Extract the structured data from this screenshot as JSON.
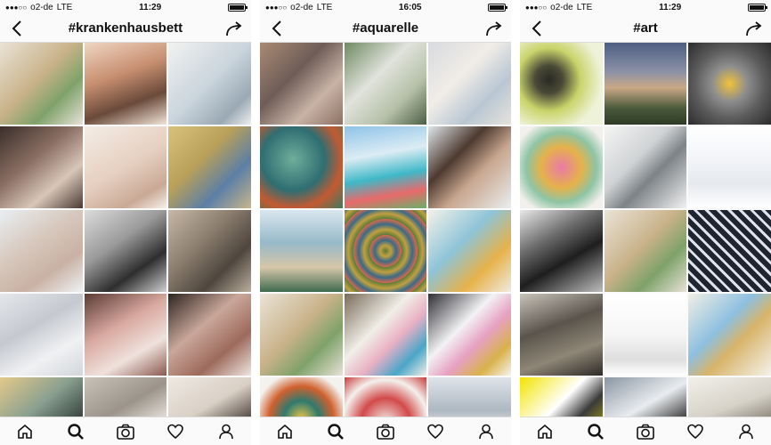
{
  "screens": [
    {
      "status": {
        "carrier": "o2-de",
        "network": "LTE",
        "time": "11:29"
      },
      "title": "#krankenhausbett",
      "tiles": [
        {
          "bg": "linear-gradient(135deg,#eae3d6 0%,#c9b28a 45%,#7fa26a 70%,#e8e2d8 100%)"
        },
        {
          "bg": "linear-gradient(160deg,#f0d6c2 0%,#c78e70 40%,#6a4a3a 70%,#f2e4d8 100%)"
        },
        {
          "bg": "linear-gradient(135deg,#f2f2f0 0%,#c9d4dc 50%,#9aa9b4 80%,#eeeeee 100%)"
        },
        {
          "bg": "linear-gradient(140deg,#3a2e2a 0%,#8a6e62 40%,#d8c6b8 70%,#4a3a34 100%)"
        },
        {
          "bg": "linear-gradient(150deg,#f4ede6 0%,#e6cfc0 50%,#c9a995 80%,#f7f0ea 100%)"
        },
        {
          "bg": "linear-gradient(135deg,#d8c27a 0%,#b9a05a 40%,#5c7fa6 70%,#c8b68a 100%)"
        },
        {
          "bg": "linear-gradient(145deg,#e9eef2 0%,#d7c8bd 40%,#c9b1a3 70%,#eef2f4 100%)"
        },
        {
          "bg": "linear-gradient(145deg,#dcdcdc 0%,#9a9a9a 40%,#2e2e2e 70%,#cfcfcf 100%)"
        },
        {
          "bg": "linear-gradient(135deg,#c7b8a6 0%,#8a7d6e 40%,#4e463e 70%,#b9ad9c 100%)"
        },
        {
          "bg": "linear-gradient(150deg,#e4e6ea 0%,#c5c9cf 40%,#f0f1f3 70%,#d2d6db 100%)"
        },
        {
          "bg": "linear-gradient(150deg,#5a3b34 0%,#d9a9a0 40%,#efe1dc 70%,#8a5a50 100%)"
        },
        {
          "bg": "linear-gradient(140deg,#2e2420 0%,#c9a79a 40%,#9d6a5c 70%,#efe6e0 100%)"
        },
        {
          "bg": "linear-gradient(140deg,#e4c98a 0%,#8aa090 40%,#3c4a44 70%,#d8c080 100%)"
        },
        {
          "bg": "linear-gradient(150deg,#c8c2b8 0%,#9c948a 40%,#e8e4de 70%,#7c766e 100%)"
        },
        {
          "bg": "linear-gradient(150deg,#efe9e2 0%,#d9d0c6 40%,#4b4038 70%,#f2ece6 100%)"
        }
      ]
    },
    {
      "status": {
        "carrier": "o2-de",
        "network": "LTE",
        "time": "16:05"
      },
      "title": "#aquarelle",
      "tiles": [
        {
          "bg": "linear-gradient(135deg,#a98a74 0%,#6e5d57 40%,#c9b3a6 70%,#8a7062 100%)"
        },
        {
          "bg": "linear-gradient(135deg,#6f8a62 0%,#e1e3dc 40%,#b6c1a9 70%,#4d5e46 100%)"
        },
        {
          "bg": "linear-gradient(135deg,#d8dade 0%,#f1ede8 40%,#b9c7d3 70%,#e6e2dc 100%)"
        },
        {
          "bg": "radial-gradient(circle at 40% 40%,#6fae9a 0%,#2f6e72 45%,#c35a32 70%,#3f7a5e 100%)"
        },
        {
          "bg": "linear-gradient(170deg,#8ec3e8 0%,#dcecf4 35%,#3fb8c8 60%,#e86a6a 80%,#6ab06a 100%)"
        },
        {
          "bg": "linear-gradient(135deg,#dfe6ea 0%,#4d3a30 35%,#c9a78f 60%,#e9eef0 100%)"
        },
        {
          "bg": "linear-gradient(180deg,#d9e7ef 0%,#97b9c9 40%,#d6c6a8 70%,#3f6a4e 100%)"
        },
        {
          "bg": "repeating-radial-gradient(circle at 50% 50%,#5a7a3a 0px,#c0a040 6px,#3c6a86 12px,#d86a4a 18px)"
        },
        {
          "bg": "linear-gradient(135deg,#f4f1ea 0%,#8ec4d8 40%,#e7b24a 70%,#efeae2 100%)"
        },
        {
          "bg": "linear-gradient(135deg,#eae3d6 0%,#c9b28a 45%,#7fa26a 70%,#e8e2d8 100%)"
        },
        {
          "bg": "linear-gradient(135deg,#7a6b5a 0%,#f0efe8 40%,#e9b0c4 60%,#4aa6c8 80%,#f2eee6 100%)"
        },
        {
          "bg": "linear-gradient(135deg,#2e2e34 0%,#f2f2f4 40%,#e7a1c2 60%,#d8b24a 80%,#f7f4f0 100%)"
        },
        {
          "bg": "radial-gradient(circle at 50% 50%,#e8c24a 0%,#2f7a6e 30%,#d0602e 55%,#f4f2ee 80%)"
        },
        {
          "bg": "radial-gradient(circle at 50% 55%,#f2eeea 0%,#d24a4a 40%,#f4f0ec 70%,#c83a3a 100%)"
        },
        {
          "bg": "linear-gradient(180deg,#dfe4ea 0%,#aeb8c2 40%,#f4f4f4 70%,#8c97a2 100%)"
        }
      ]
    },
    {
      "status": {
        "carrier": "o2-de",
        "network": "LTE",
        "time": "11:29"
      },
      "title": "#art",
      "tiles": [
        {
          "bg": "radial-gradient(circle at 35% 45%,#2a2a24 0%,#4a4a38 20%,#c9d46a 45%,#eef2d8 75%)"
        },
        {
          "bg": "linear-gradient(180deg,#4e5f82 0%,#8a90a6 35%,#c9a886 55%,#4a5a3a 80%,#2e3a26 100%)"
        },
        {
          "bg": "radial-gradient(circle at 50% 50%,#f2c23a 0%,#8e8e8e 30%,#5c5c5c 60%,#2c2c2c 100%)"
        },
        {
          "bg": "radial-gradient(circle at 50% 50%,#e87aa8 0%,#e6b24a 35%,#8ec4a4 60%,#f2f0ec 85%)"
        },
        {
          "bg": "linear-gradient(135deg,#f4f4f4 0%,#cfd2d4 40%,#7d8387 60%,#f2f2f2 100%)"
        },
        {
          "bg": "linear-gradient(180deg,#ffffff 0%,#f2f4f8 40%,#e6e9ee 70%,#ffffff 100%)"
        },
        {
          "bg": "linear-gradient(150deg,#e9e9e9 0%,#6a6a6a 35%,#1e1e1e 60%,#bdbdbd 100%)"
        },
        {
          "bg": "linear-gradient(135deg,#eae3d6 0%,#c9b28a 45%,#7fa26a 70%,#e8e2d8 100%)"
        },
        {
          "bg": "repeating-linear-gradient(45deg,#1e2430 0px,#1e2430 6px,#dfe2ea 6px,#dfe2ea 9px)"
        },
        {
          "bg": "linear-gradient(160deg,#c9c4ba 0%,#5a544c 40%,#8e8676 70%,#2e2a26 100%)"
        },
        {
          "bg": "linear-gradient(180deg,#ffffff 0%,#f6f6f6 50%,#dedede 80%,#ffffff 100%)"
        },
        {
          "bg": "linear-gradient(135deg,#f2efe6 0%,#8ec0e0 40%,#d8b46a 60%,#f4f2ec 100%)"
        },
        {
          "bg": "linear-gradient(135deg,#f2e400 0%,#ffffff 40%,#3a3a3a 60%,#f2e400 100%)"
        },
        {
          "bg": "linear-gradient(150deg,#8a96a2 0%,#e9ecef 40%,#2e2e2e 70%,#cfd4d8 100%)"
        },
        {
          "bg": "linear-gradient(160deg,#f2f0ea 0%,#d6d2c8 40%,#7a7468 70%,#f4f2ee 100%)"
        }
      ]
    }
  ],
  "icons": {
    "back": "back-chevron-icon",
    "share": "share-arrow-icon",
    "home": "home-icon",
    "search": "search-icon",
    "camera": "camera-icon",
    "heart": "heart-icon",
    "profile": "profile-icon"
  }
}
